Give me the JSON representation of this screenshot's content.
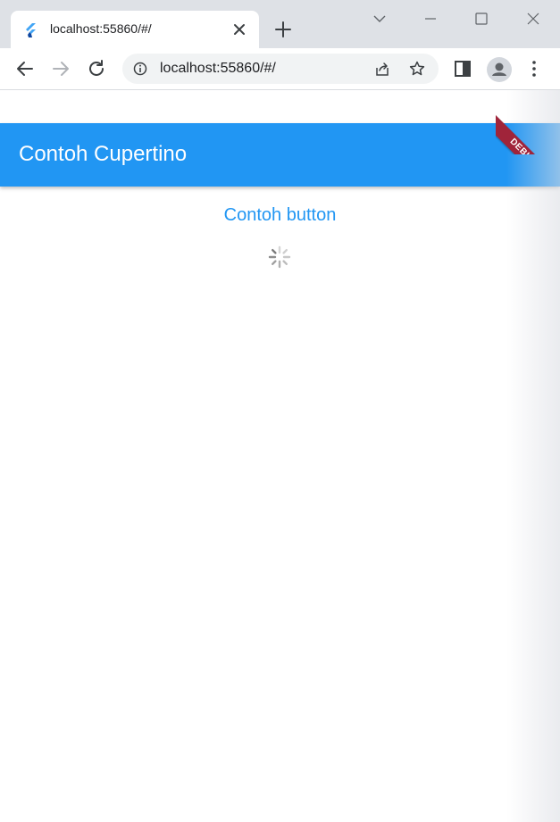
{
  "browser": {
    "tab": {
      "title": "localhost:55860/#/",
      "favicon": "flutter-icon"
    },
    "address_bar": {
      "url": "localhost:55860/#/"
    },
    "colors": {
      "tab_strip": "#dee1e6",
      "omnibox": "#f1f3f4"
    }
  },
  "app": {
    "appbar": {
      "title": "Contoh Cupertino"
    },
    "body": {
      "button_label": "Contoh button",
      "loading_indicator": "activity-indicator-icon"
    },
    "debug_banner": {
      "label": "DEBUG"
    },
    "colors": {
      "primary": "#2196f3",
      "banner": "#a0243a"
    }
  }
}
